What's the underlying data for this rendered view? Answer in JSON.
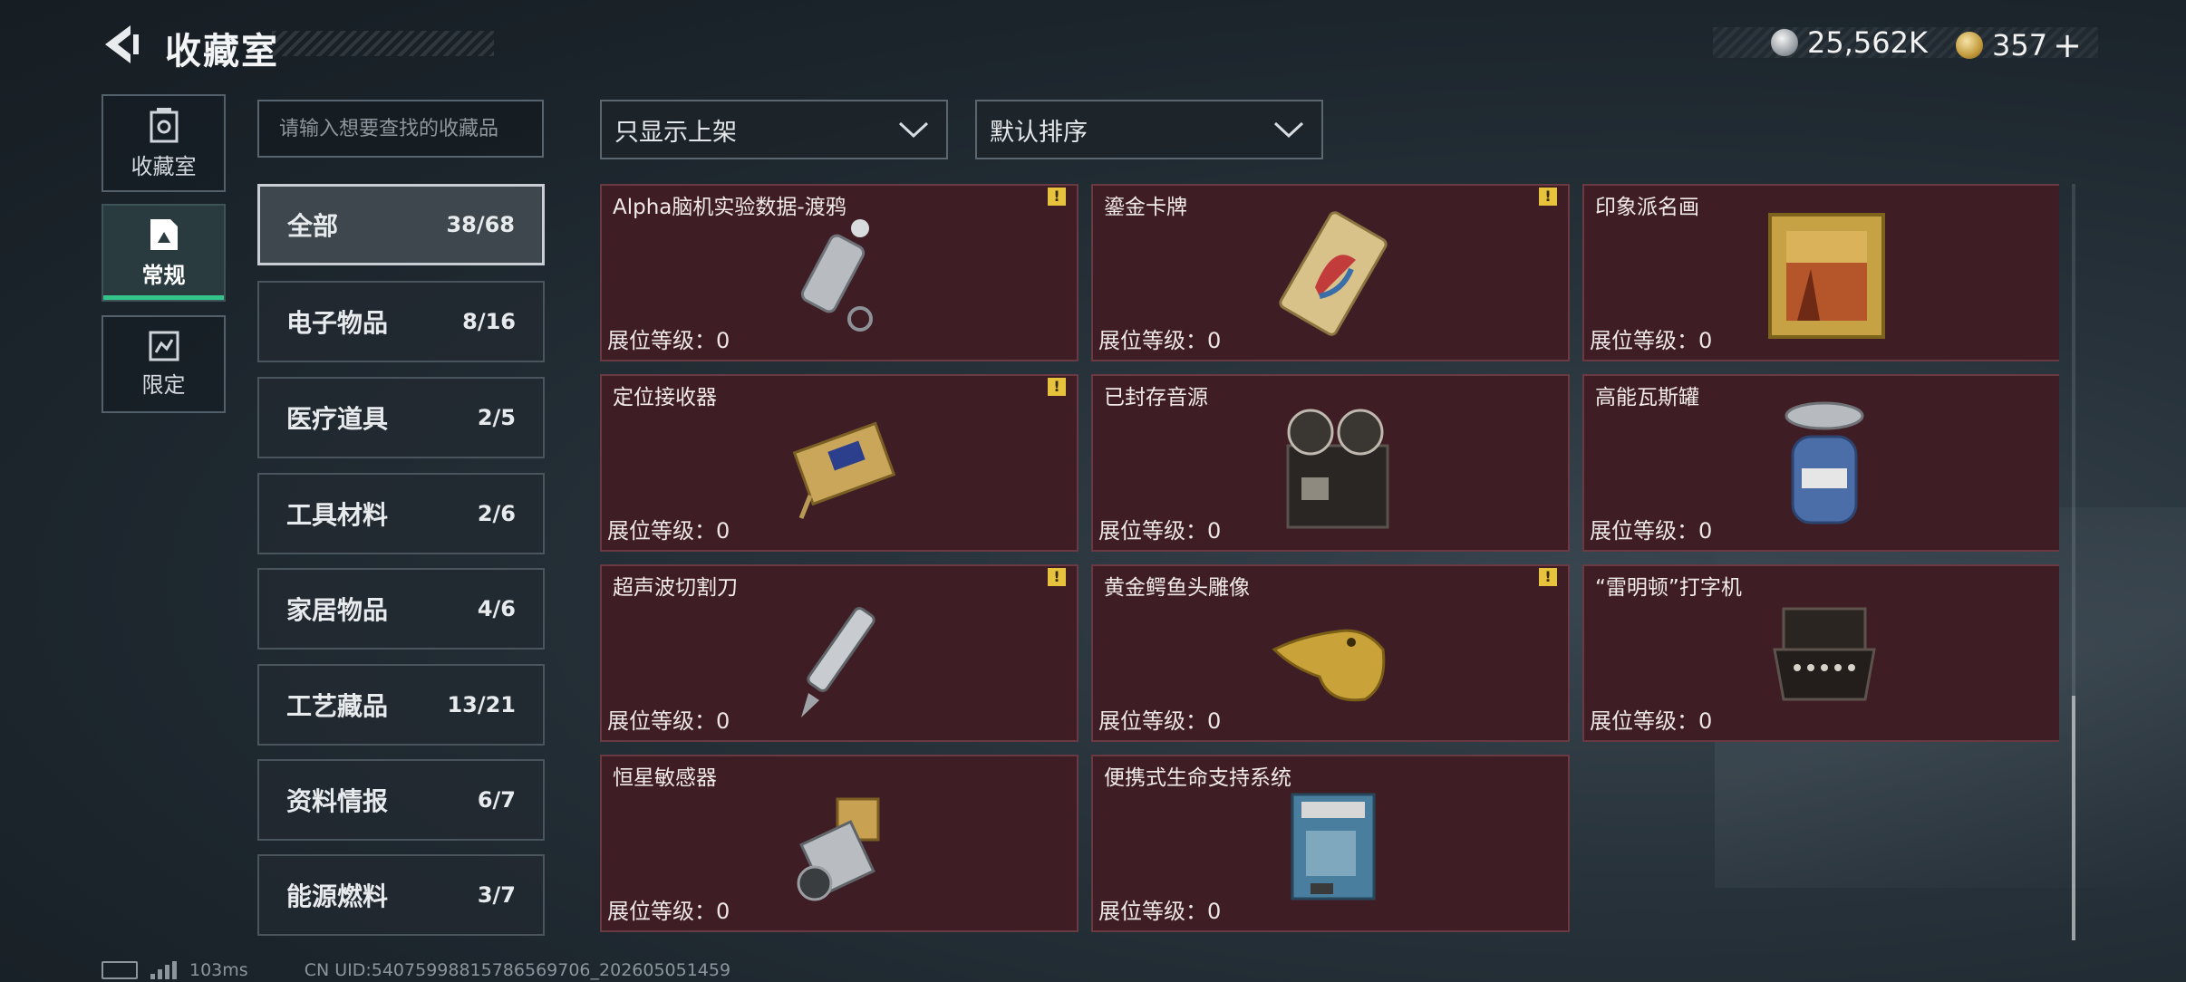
{
  "header": {
    "title": "收藏室",
    "currency_silver": "25,562K",
    "currency_gold": "357"
  },
  "nav": [
    {
      "label": "收藏室",
      "icon": "collection-room-icon",
      "active": false
    },
    {
      "label": "常规",
      "icon": "regular-icon",
      "active": true
    },
    {
      "label": "限定",
      "icon": "limited-icon",
      "active": false
    }
  ],
  "search": {
    "placeholder": "请输入想要查找的收藏品"
  },
  "filters": {
    "display_filter": "只显示上架",
    "sort": "默认排序"
  },
  "categories": [
    {
      "name": "全部",
      "count": "38/68",
      "active": true
    },
    {
      "name": "电子物品",
      "count": "8/16"
    },
    {
      "name": "医疗道具",
      "count": "2/5"
    },
    {
      "name": "工具材料",
      "count": "2/6"
    },
    {
      "name": "家居物品",
      "count": "4/6"
    },
    {
      "name": "工艺藏品",
      "count": "13/21"
    },
    {
      "name": "资料情报",
      "count": "6/7"
    },
    {
      "name": "能源燃料",
      "count": "3/7"
    }
  ],
  "items": [
    {
      "name": "Alpha脑机实验数据-渡鸦",
      "level": "展位等级：0",
      "warning": true,
      "icon": "flashlight-keychain-icon"
    },
    {
      "name": "鎏金卡牌",
      "level": "展位等级：0",
      "warning": true,
      "icon": "gilded-card-icon"
    },
    {
      "name": "印象派名画",
      "level": "展位等级：0",
      "warning": false,
      "icon": "framed-painting-icon"
    },
    {
      "name": "定位接收器",
      "level": "展位等级：0",
      "warning": true,
      "icon": "locator-receiver-icon"
    },
    {
      "name": "已封存音源",
      "level": "展位等级：0",
      "warning": false,
      "icon": "reel-recorder-icon"
    },
    {
      "name": "高能瓦斯罐",
      "level": "展位等级：0",
      "warning": false,
      "icon": "gas-canister-icon"
    },
    {
      "name": "超声波切割刀",
      "level": "展位等级：0",
      "warning": true,
      "icon": "ultrasonic-knife-icon"
    },
    {
      "name": "黄金鳄鱼头雕像",
      "level": "展位等级：0",
      "warning": true,
      "icon": "golden-crocodile-icon"
    },
    {
      "name": "“雷明顿”打字机",
      "level": "展位等级：0",
      "warning": false,
      "icon": "typewriter-icon"
    },
    {
      "name": "恒星敏感器",
      "level": "展位等级：0",
      "warning": false,
      "icon": "star-sensor-icon"
    },
    {
      "name": "便携式生命支持系统",
      "level": "展位等级：0",
      "warning": false,
      "icon": "life-support-icon"
    }
  ],
  "warning_glyph": "!",
  "status": {
    "ping": "103ms",
    "uid": "CN UID:5407599881578656970​6_202605051459"
  }
}
